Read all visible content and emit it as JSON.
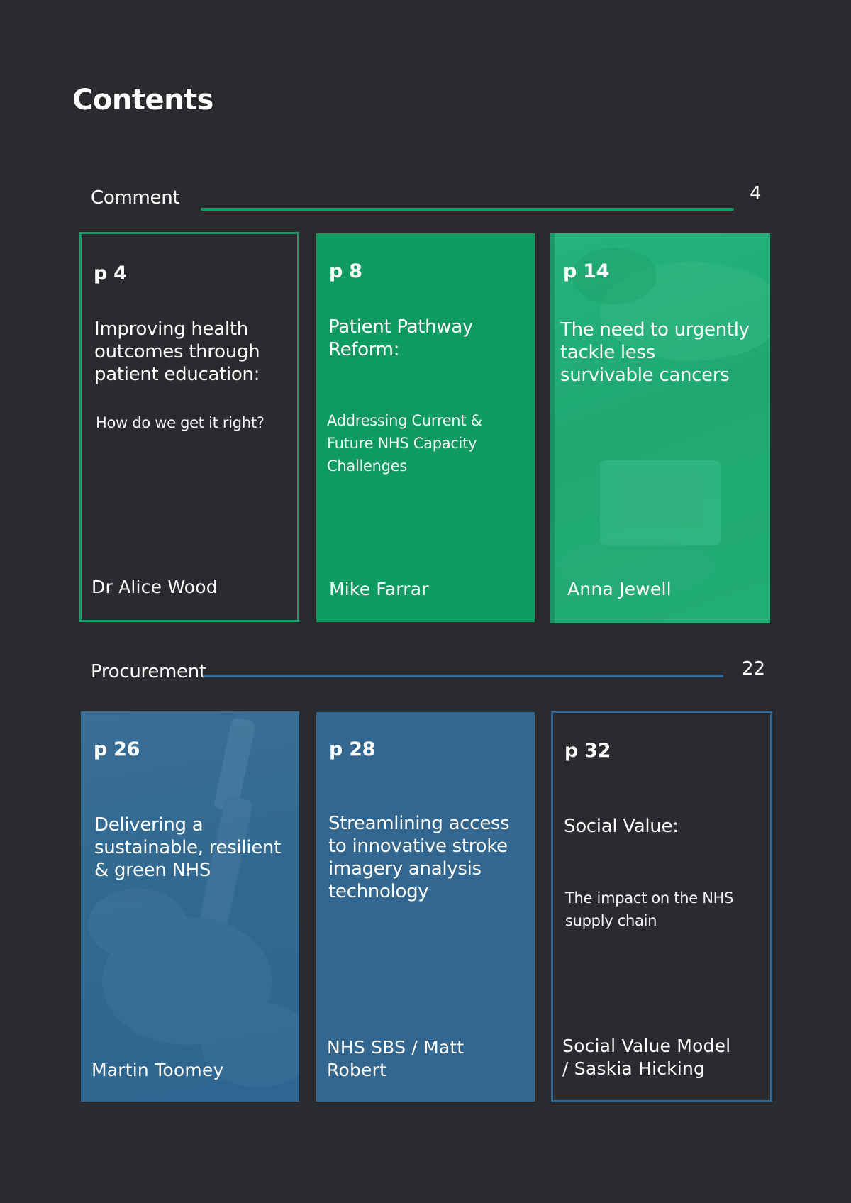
{
  "page": {
    "title": "Contents"
  },
  "colors": {
    "background": "#2a2b2f",
    "green": "#0e9a60",
    "blue": "#33678f"
  },
  "sections": [
    {
      "label": "Comment",
      "number": "4",
      "cards": [
        {
          "page": "p 4",
          "headline": "Improving health outcomes through patient education:",
          "subtitle": "How do we get it right?",
          "author": "Dr Alice Wood"
        },
        {
          "page": "p 8",
          "headline": "Patient Pathway Reform:",
          "subtitle": "Addressing Current & Future NHS Capacity Challenges",
          "author": "Mike Farrar"
        },
        {
          "page": "p 14",
          "headline": "The need to urgently tackle less survivable cancers",
          "subtitle": "",
          "author": "Anna Jewell"
        }
      ]
    },
    {
      "label": "Procurement",
      "number": "22",
      "cards": [
        {
          "page": "p 26",
          "headline": "Delivering a sustainable, resilient & green NHS",
          "subtitle": "",
          "author": "Martin Toomey"
        },
        {
          "page": "p 28",
          "headline": "Streamlining access to innovative stroke imagery analysis technology",
          "subtitle": "",
          "author": "NHS SBS / Matt Robert"
        },
        {
          "page": "p 32",
          "headline": "Social Value:",
          "subtitle": "The impact on the NHS supply chain",
          "author": "Social Value Model / Saskia Hicking"
        }
      ]
    }
  ]
}
